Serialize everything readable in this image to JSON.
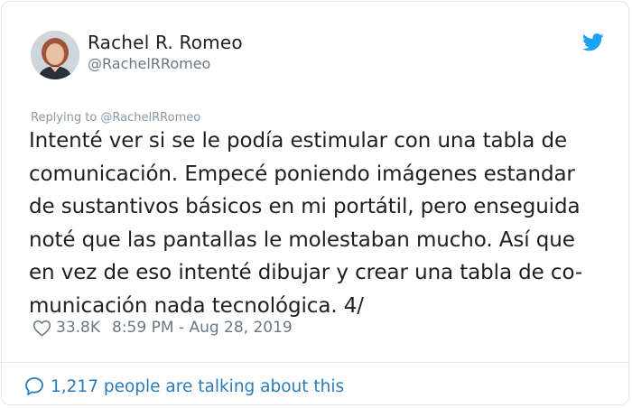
{
  "author": {
    "name": "Rachel R. Romeo",
    "handle": "@RachelRRomeo"
  },
  "tweet": {
    "replying_to": "Replying to @RachelRRomeo",
    "text": "Intenté ver si se le podía estimular con una tabla de\ncomunicación. Empecé poniendo imágenes estandar\nde sustantivos básicos en mi portátil, pero enseguida\nnoté que las pantallas le molestaban mucho. Así que\nen vez de eso intenté dibujar y crear una tabla de co-\nmunicación nada tecnológica. 4/",
    "likes": "33.8K",
    "timestamp": "8:59 PM - Aug 28, 2019"
  },
  "footer": {
    "talking_label": "1,217 people are talking about this"
  },
  "icons": {
    "brand": "twitter-bird-icon",
    "like": "heart-icon",
    "talk": "speech-bubble-icon"
  },
  "colors": {
    "brand_blue": "#1da1f2",
    "link_blue": "#2b7bb9",
    "text": "#1c2022",
    "muted": "#697882",
    "border": "#e1e8ed"
  }
}
